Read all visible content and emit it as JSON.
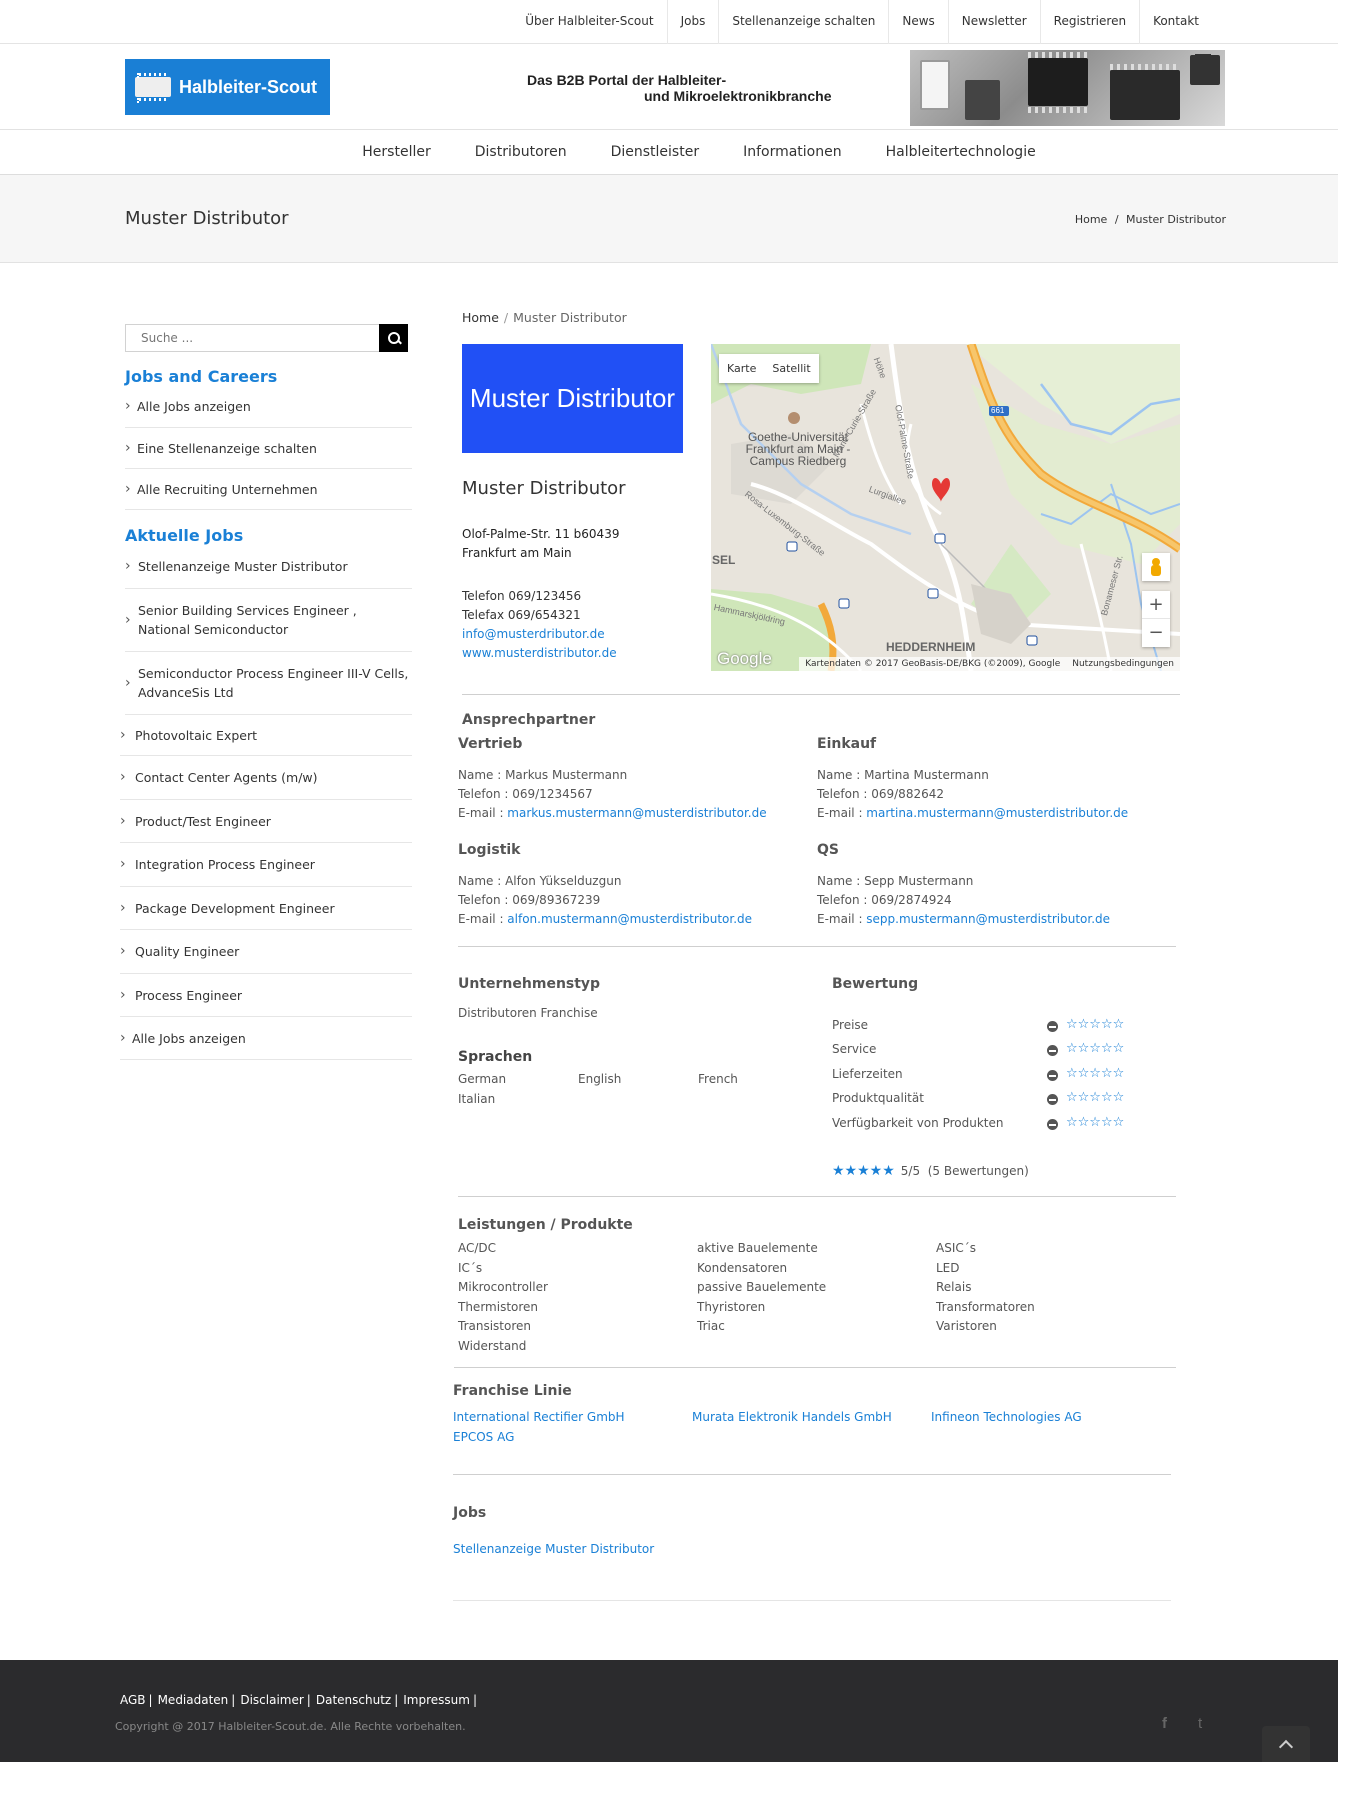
{
  "topnav": [
    "Über Halbleiter-Scout",
    "Jobs",
    "Stellenanzeige schalten",
    "News",
    "Newsletter",
    "Registrieren",
    "Kontakt"
  ],
  "logo": {
    "text": "Halbleiter-Scout"
  },
  "banner": {
    "line1": "Das B2B Portal der Halbleiter-",
    "line2": "und Mikroelektronikbranche"
  },
  "mainnav": [
    "Hersteller",
    "Distributoren",
    "Dienstleister",
    "Informationen",
    "Halbleitertechnologie"
  ],
  "page": {
    "title": "Muster Distributor",
    "crumb_home": "Home",
    "crumb_sep": "/",
    "crumb_current": "Muster Distributor"
  },
  "sidebar": {
    "search_placeholder": "Suche ...",
    "jobs_heading": "Jobs and Careers",
    "jobs_links": [
      "Alle Jobs anzeigen",
      "Eine Stellenanzeige schalten",
      "Alle Recruiting Unternehmen"
    ],
    "current_heading": "Aktuelle Jobs",
    "current_jobs": [
      "Stellenanzeige Muster Distributor",
      "Senior Building Services Engineer , National Semiconductor",
      "Semiconductor Process Engineer III-V Cells, AdvanceSis Ltd",
      "Photovoltaic Expert",
      "Contact Center Agents (m/w)",
      "Product/Test Engineer",
      "Integration Process Engineer",
      "Package Development Engineer",
      "Quality Engineer",
      "Process Engineer",
      "Alle Jobs anzeigen"
    ]
  },
  "company": {
    "logo_text": "Muster Distributor",
    "name": "Muster Distributor",
    "address": "Olof-Palme-Str. 11 b60439 Frankfurt am Main",
    "phone": "Telefon 069/123456",
    "fax": "Telefax 069/654321",
    "email": "info@musterdributor.de",
    "web": "www.musterdistributor.de"
  },
  "map": {
    "type_map": "Karte",
    "type_sat": "Satellit",
    "place": "Goethe-Universität Frankfurt am Main - Campus Riedberg",
    "district": "HEDDERNHEIM",
    "edge_label": "SEL",
    "streets": [
      "Marie-Curie-Straße",
      "Olof-Palme-Straße",
      "Rosa-Luxemburg-Straße",
      "Hammarskjöldring",
      "Lurgiallee",
      "Bonameser Str.",
      "Höhe"
    ],
    "highway": "661",
    "zoom_in": "+",
    "zoom_out": "−",
    "google": "Google",
    "attribution": "Kartendaten © 2017 GeoBasis-DE/BKG (©2009), Google",
    "terms": "Nutzungsbedingungen"
  },
  "contacts": {
    "heading": "Ansprechpartner",
    "name_label": "Name : ",
    "phone_label": "Telefon : ",
    "email_label": "E-mail : ",
    "groups": [
      {
        "title": "Vertrieb",
        "name": "Markus Mustermann",
        "phone": "069/1234567",
        "email": "markus.mustermann@musterdistributor.de"
      },
      {
        "title": "Einkauf",
        "name": "Martina Mustermann",
        "phone": "069/882642",
        "email": "martina.mustermann@musterdistributor.de"
      },
      {
        "title": "Logistik",
        "name": "Alfon Yükselduzgun",
        "phone": "069/89367239",
        "email": "alfon.mustermann@musterdistributor.de"
      },
      {
        "title": "QS",
        "name": "Sepp Mustermann",
        "phone": "069/2874924",
        "email": "sepp.mustermann@musterdistributor.de"
      }
    ]
  },
  "company_type": {
    "heading": "Unternehmenstyp",
    "value": "Distributoren Franchise"
  },
  "languages": {
    "heading": "Sprachen",
    "items": [
      "German",
      "English",
      "French",
      "Italian"
    ]
  },
  "rating": {
    "heading": "Bewertung",
    "criteria": [
      "Preise",
      "Service",
      "Lieferzeiten",
      "Produktqualität",
      "Verfügbarkeit von Produkten"
    ],
    "criteria_scores": [
      0,
      0,
      0,
      0,
      0
    ],
    "empty_stars": "☆☆☆☆☆",
    "filled_stars": "★★★★★",
    "average": 5,
    "average_text": "5/5",
    "count_text": "(5 Bewertungen)"
  },
  "products": {
    "heading": "Leistungen / Produkte",
    "items": [
      "AC/DC",
      "aktive Bauelemente",
      "ASIC´s",
      "IC´s",
      "Kondensatoren",
      "LED",
      "Mikrocontroller",
      "passive Bauelemente",
      "Relais",
      "Thermistoren",
      "Thyristoren",
      "Transformatoren",
      "Transistoren",
      "Triac",
      "Varistoren",
      "Widerstand"
    ]
  },
  "franchise": {
    "heading": "Franchise Linie",
    "items": [
      "International Rectifier GmbH",
      "Murata Elektronik Handels GmbH",
      "Infineon Technologies AG",
      "EPCOS AG"
    ]
  },
  "jobs": {
    "heading": "Jobs",
    "items": [
      "Stellenanzeige Muster Distributor"
    ]
  },
  "footer": {
    "links": [
      "AGB",
      "Mediadaten",
      "Disclaimer",
      "Datenschutz",
      "Impressum"
    ],
    "copyright": "Copyright @ 2017 Halbleiter-Scout.de. Alle Rechte vorbehalten.",
    "facebook": "f",
    "twitter": "t"
  },
  "colors": {
    "accent": "#1a80d6",
    "distributor_logo": "#2150f5",
    "footer": "#2b2b2d"
  }
}
